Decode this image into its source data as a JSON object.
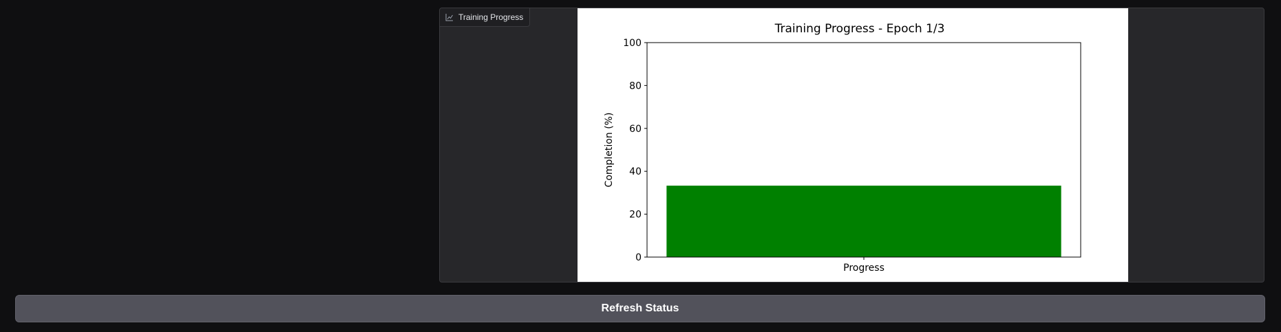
{
  "plot_panel": {
    "label": "Training Progress",
    "label_icon": "chart-icon"
  },
  "refresh_button": {
    "label": "Refresh Status"
  },
  "colors": {
    "bar": "#008000",
    "page_background": "#0f0f11",
    "panel_background": "#27272a",
    "button_background": "#52525b"
  },
  "chart_data": {
    "type": "bar",
    "title": "Training Progress - Epoch 1/3",
    "categories": [
      "Progress"
    ],
    "values": [
      33.3
    ],
    "xlabel": "",
    "ylabel": "Completion (%)",
    "ylim": [
      0,
      100
    ],
    "yticks": [
      0,
      20,
      40,
      60,
      80,
      100
    ],
    "grid": false,
    "legend": "none"
  }
}
